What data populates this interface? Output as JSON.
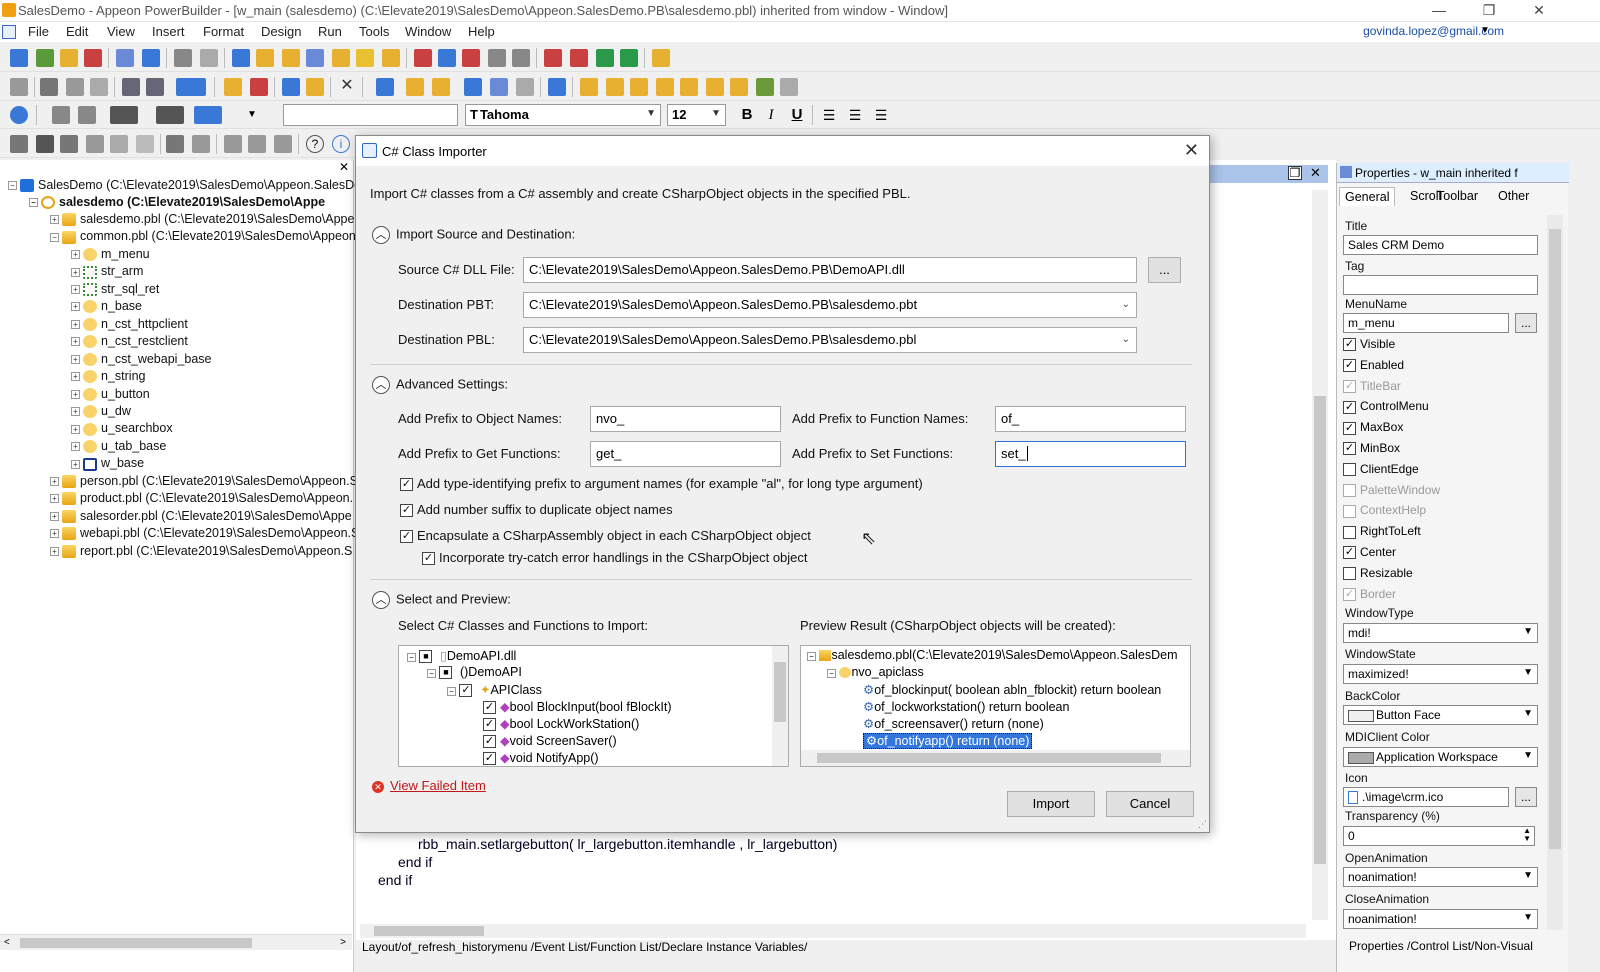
{
  "window": {
    "title": "SalesDemo - Appeon PowerBuilder - [w_main (salesdemo) (C:\\Elevate2019\\SalesDemo\\Appeon.SalesDemo.PB\\salesdemo.pbl) inherited from window - Window]",
    "min": "—",
    "max": "❐",
    "close": "✕"
  },
  "menubar": {
    "items": [
      "File",
      "Edit",
      "View",
      "Insert",
      "Format",
      "Design",
      "Run",
      "Tools",
      "Window",
      "Help"
    ],
    "email": "govinda.lopez@gmail.com"
  },
  "toolbar": {
    "font_name": "Tahoma",
    "font_size": "12",
    "bold": "B",
    "italic": "I",
    "underline": "U"
  },
  "tree": {
    "root": "SalesDemo (C:\\Elevate2019\\SalesDemo\\Appeon.SalesDer",
    "target": "salesdemo (C:\\Elevate2019\\SalesDemo\\Appe",
    "items": [
      {
        "label": "salesdemo.pbl (C:\\Elevate2019\\SalesDemo\\Appe",
        "kind": "pbl"
      },
      {
        "label": "common.pbl (C:\\Elevate2019\\SalesDemo\\Appeon.",
        "kind": "pbl"
      },
      {
        "label": "m_menu",
        "kind": "obj"
      },
      {
        "label": "str_arm",
        "kind": "str"
      },
      {
        "label": "str_sql_ret",
        "kind": "str"
      },
      {
        "label": "n_base",
        "kind": "obj"
      },
      {
        "label": "n_cst_httpclient",
        "kind": "obj"
      },
      {
        "label": "n_cst_restclient",
        "kind": "obj"
      },
      {
        "label": "n_cst_webapi_base",
        "kind": "obj"
      },
      {
        "label": "n_string",
        "kind": "obj"
      },
      {
        "label": "u_button",
        "kind": "obj"
      },
      {
        "label": "u_dw",
        "kind": "obj"
      },
      {
        "label": "u_searchbox",
        "kind": "obj"
      },
      {
        "label": "u_tab_base",
        "kind": "obj"
      },
      {
        "label": "w_base",
        "kind": "win"
      },
      {
        "label": "person.pbl (C:\\Elevate2019\\SalesDemo\\Appeon.S",
        "kind": "pbl"
      },
      {
        "label": "product.pbl (C:\\Elevate2019\\SalesDemo\\Appeon.",
        "kind": "pbl"
      },
      {
        "label": "salesorder.pbl (C:\\Elevate2019\\SalesDemo\\Appe",
        "kind": "pbl"
      },
      {
        "label": "webapi.pbl (C:\\Elevate2019\\SalesDemo\\Appeon.S",
        "kind": "pbl"
      },
      {
        "label": "report.pbl (C:\\Elevate2019\\SalesDemo\\Appeon.S",
        "kind": "pbl"
      }
    ]
  },
  "dialog": {
    "title": "C# Class Importer",
    "description": "Import C# classes from a C# assembly and create CSharpObject objects in the specified PBL.",
    "section1": "Import Source and Destination:",
    "source_label": "Source C# DLL File:",
    "source_value": "C:\\Elevate2019\\SalesDemo\\Appeon.SalesDemo.PB\\DemoAPI.dll",
    "browse": "...",
    "pbt_label": "Destination PBT:",
    "pbt_value": "C:\\Elevate2019\\SalesDemo\\Appeon.SalesDemo.PB\\salesdemo.pbt",
    "pbl_label": "Destination PBL:",
    "pbl_value": "C:\\Elevate2019\\SalesDemo\\Appeon.SalesDemo.PB\\salesdemo.pbl",
    "section2": "Advanced Settings:",
    "obj_prefix_label": "Add Prefix to Object Names:",
    "obj_prefix_value": "nvo_",
    "func_prefix_label": "Add Prefix to Function Names:",
    "func_prefix_value": "of_",
    "get_prefix_label": "Add Prefix to Get Functions:",
    "get_prefix_value": "get_",
    "set_prefix_label": "Add Prefix to Set Functions:",
    "set_prefix_value": "set_",
    "opt1": "Add type-identifying prefix to argument names  (for example \"al\", for long type argument)",
    "opt2": "Add number suffix to duplicate object names",
    "opt3": "Encapsulate a CSharpAssembly object in each CSharpObject object",
    "opt4": "Incorporate try-catch error handlings in the CSharpObject object",
    "section3": "Select and Preview:",
    "select_label": "Select C# Classes and Functions to Import:",
    "preview_label": "Preview Result (CSharpObject objects will be created):",
    "select_tree": [
      "DemoAPI.dll",
      "DemoAPI",
      "APIClass",
      "bool BlockInput(bool fBlockIt)",
      "bool LockWorkStation()",
      "void ScreenSaver()",
      "void NotifyApp()"
    ],
    "preview_tree": [
      "salesdemo.pbl(C:\\Elevate2019\\SalesDemo\\Appeon.SalesDem",
      "nvo_apiclass",
      "of_blockinput( boolean abln_fblockit) return boolean",
      "of_lockworkstation() return boolean",
      "of_screensaver() return (none)",
      "of_notifyapp() return (none)"
    ],
    "failed_link": "View Failed Item",
    "import": "Import",
    "cancel": "Cancel"
  },
  "code": {
    "lines": [
      "rbb_main.setlargebutton( lr_largebutton.itemhandle , lr_largebutton)",
      "end if",
      "end if"
    ]
  },
  "bottom_tabs": "Layout/of_refresh_historymenu /Event List/Function List/Declare Instance Variables/",
  "props": {
    "header": "Properties - w_main  inherited  f",
    "tabs": [
      "General",
      "Scroll",
      "Toolbar",
      "Other"
    ],
    "title_label": "Title",
    "title_value": "Sales CRM Demo",
    "tag_label": "Tag",
    "tag_value": "",
    "menuname_label": "MenuName",
    "menuname_value": "m_menu",
    "checks": [
      {
        "label": "Visible",
        "checked": true,
        "dim": false
      },
      {
        "label": "Enabled",
        "checked": true,
        "dim": false
      },
      {
        "label": "TitleBar",
        "checked": true,
        "dim": true
      },
      {
        "label": "ControlMenu",
        "checked": true,
        "dim": false
      },
      {
        "label": "MaxBox",
        "checked": true,
        "dim": false
      },
      {
        "label": "MinBox",
        "checked": true,
        "dim": false
      },
      {
        "label": "ClientEdge",
        "checked": false,
        "dim": false
      },
      {
        "label": "PaletteWindow",
        "checked": false,
        "dim": true
      },
      {
        "label": "ContextHelp",
        "checked": false,
        "dim": true
      },
      {
        "label": "RightToLeft",
        "checked": false,
        "dim": false
      },
      {
        "label": "Center",
        "checked": true,
        "dim": false
      },
      {
        "label": "Resizable",
        "checked": false,
        "dim": false
      },
      {
        "label": "Border",
        "checked": true,
        "dim": true
      }
    ],
    "windowtype_label": "WindowType",
    "windowtype_value": "mdi!",
    "windowstate_label": "WindowState",
    "windowstate_value": "maximized!",
    "backcolor_label": "BackColor",
    "backcolor_value": "Button Face",
    "mdiclient_label": "MDIClient Color",
    "mdiclient_value": "Application Workspace",
    "icon_label": "Icon",
    "icon_value": ".\\image\\crm.ico",
    "transparency_label": "Transparency (%)",
    "transparency_value": "0",
    "openanim_label": "OpenAnimation",
    "openanim_value": "noanimation!",
    "closeanim_label": "CloseAnimation",
    "closeanim_value": "noanimation!",
    "bottom_tabs": "Properties /Control List/Non-Visual"
  },
  "colors": {
    "accent": "#3377dd",
    "link": "#c0181a",
    "email": "#1a4ea8"
  }
}
